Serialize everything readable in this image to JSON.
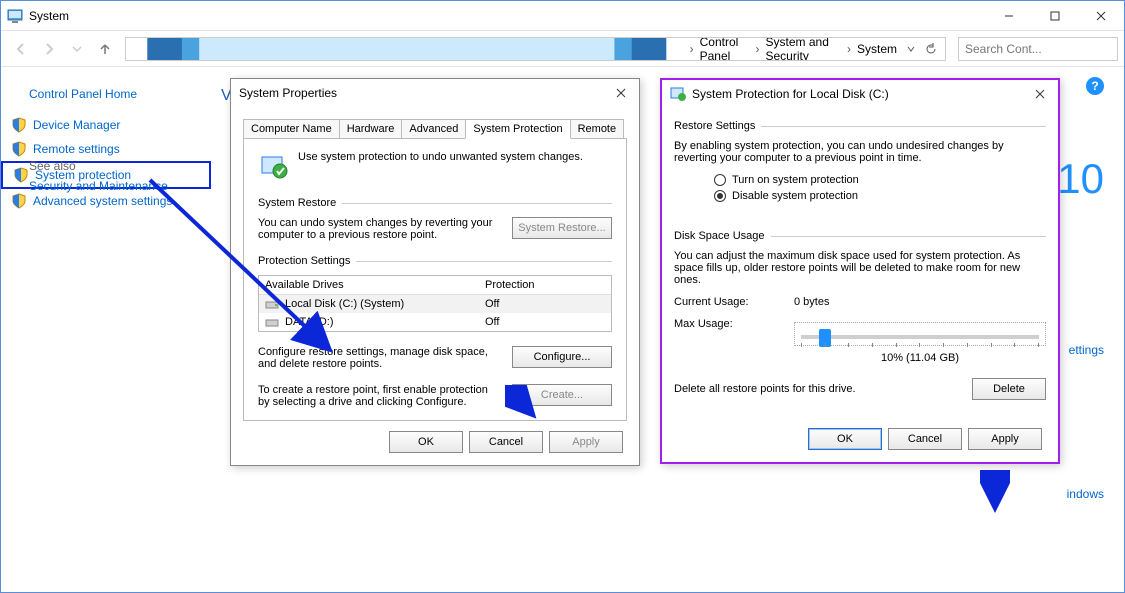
{
  "window": {
    "title": "System",
    "search_placeholder": "Search Cont...",
    "breadcrumbs": [
      "Control Panel",
      "System and Security",
      "System"
    ]
  },
  "left": {
    "home": "Control Panel Home",
    "links": [
      "Device Manager",
      "Remote settings",
      "System protection",
      "Advanced system settings"
    ],
    "see_also": "See also",
    "sec_maint": "Security and Maintenance"
  },
  "right": {
    "ten": "10",
    "link1": "ettings",
    "link2": "indows"
  },
  "sysprops": {
    "title": "System Properties",
    "tabs": [
      "Computer Name",
      "Hardware",
      "Advanced",
      "System Protection",
      "Remote"
    ],
    "active_tab": 3,
    "lead": "Use system protection to undo unwanted system changes.",
    "restore_group": "System Restore",
    "restore_desc": "You can undo system changes by reverting your computer to a previous restore point.",
    "restore_btn": "System Restore...",
    "prot_group": "Protection Settings",
    "hdr_drives": "Available Drives",
    "hdr_prot": "Protection",
    "drives": [
      {
        "name": "Local Disk (C:) (System)",
        "prot": "Off"
      },
      {
        "name": "DATA (D:)",
        "prot": "Off"
      }
    ],
    "cfg_desc": "Configure restore settings, manage disk space, and delete restore points.",
    "cfg_btn": "Configure...",
    "create_desc": "To create a restore point, first enable protection by selecting a drive and clicking Configure.",
    "create_btn": "Create...",
    "ok": "OK",
    "cancel": "Cancel",
    "apply": "Apply"
  },
  "protdlg": {
    "title": "System Protection for Local Disk (C:)",
    "group_rs": "Restore Settings",
    "rs_desc": "By enabling system protection, you can undo undesired changes by reverting your computer to a previous point in time.",
    "opt_on": "Turn on system protection",
    "opt_off": "Disable system protection",
    "group_du": "Disk Space Usage",
    "du_desc": "You can adjust the maximum disk space used for system protection. As space fills up, older restore points will be deleted to make room for new ones.",
    "cur_lbl": "Current Usage:",
    "cur_val": "0 bytes",
    "max_lbl": "Max Usage:",
    "slider_pct": 10,
    "slider_caption": "10% (11.04 GB)",
    "del_desc": "Delete all restore points for this drive.",
    "del_btn": "Delete",
    "ok": "OK",
    "cancel": "Cancel",
    "apply": "Apply"
  }
}
